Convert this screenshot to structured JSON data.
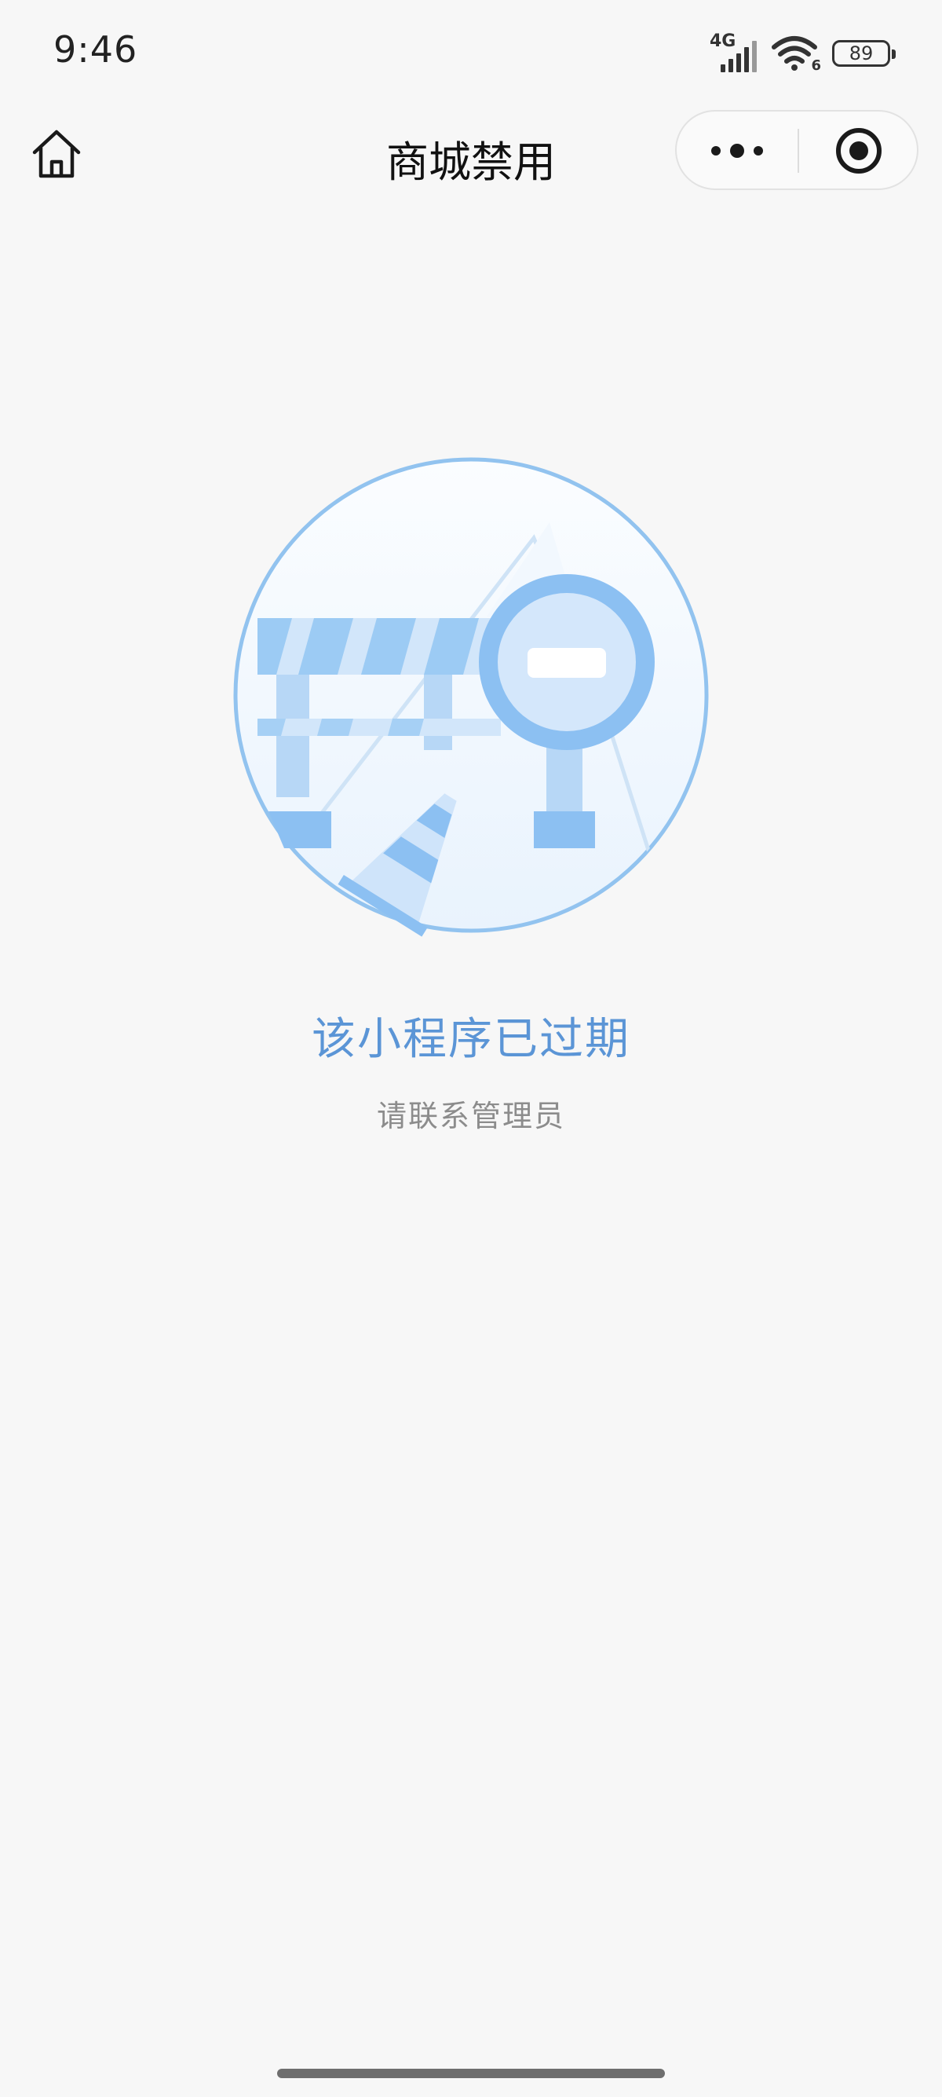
{
  "status_bar": {
    "time": "9:46",
    "network": "4G",
    "wifi_badge": "6",
    "battery": "89"
  },
  "nav": {
    "title": "商城禁用"
  },
  "content": {
    "title": "该小程序已过期",
    "subtitle": "请联系管理员"
  },
  "colors": {
    "accent": "#5b95d6",
    "background": "#f7f7f7"
  }
}
